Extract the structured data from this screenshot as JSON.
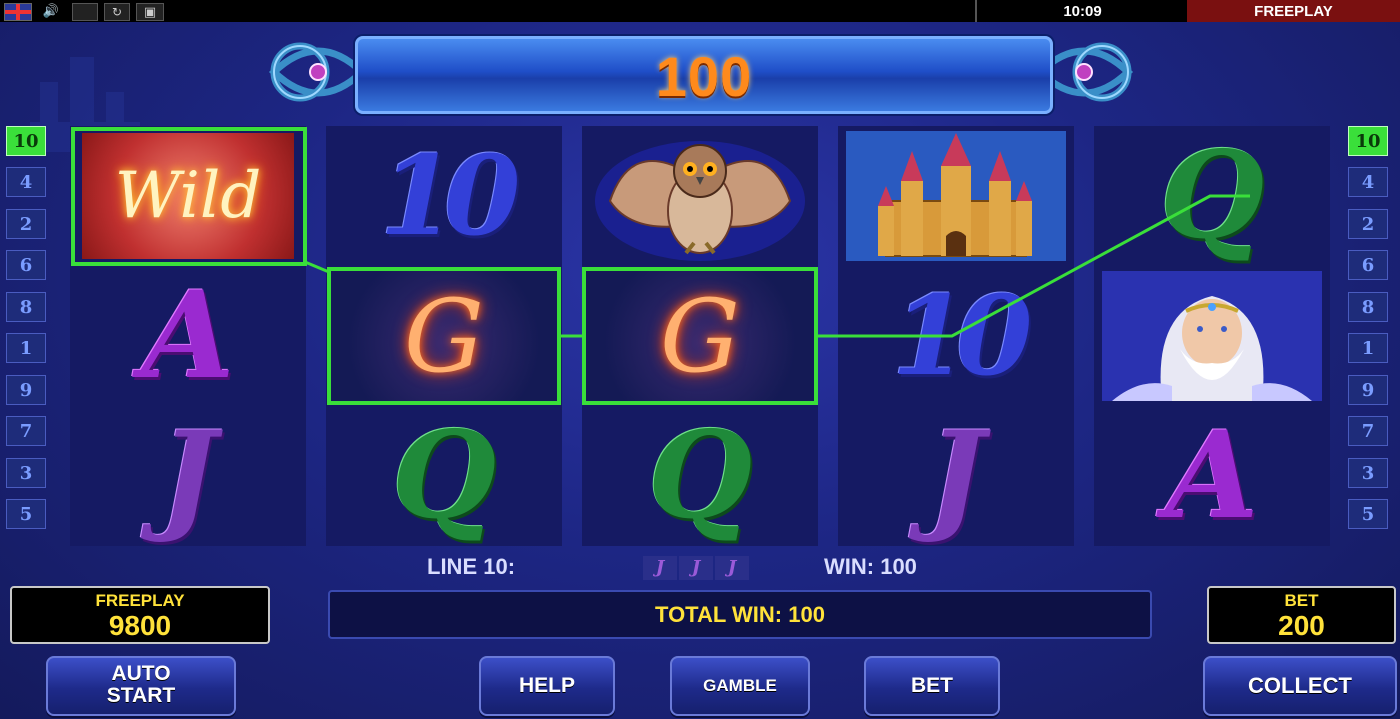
{
  "topbar": {
    "clock": "10:09",
    "mode_label": "FREEPLAY",
    "icons": [
      "uk-flag-icon",
      "speaker-icon",
      "fullscreen-icon",
      "reload-icon",
      "window-icon"
    ]
  },
  "win_display": {
    "value": "100"
  },
  "lines": {
    "left": [
      "10",
      "4",
      "2",
      "6",
      "8",
      "1",
      "9",
      "7",
      "3",
      "5"
    ],
    "right": [
      "10",
      "4",
      "2",
      "6",
      "8",
      "1",
      "9",
      "7",
      "3",
      "5"
    ],
    "active": "10"
  },
  "reels": [
    [
      "wild",
      "A",
      "J"
    ],
    [
      "10",
      "G",
      "Q"
    ],
    [
      "owl",
      "G",
      "Q"
    ],
    [
      "castle",
      "10",
      "J"
    ],
    [
      "Q",
      "wizard",
      "A"
    ]
  ],
  "symbols": {
    "wild_text": "Wild",
    "g_glyph": "G",
    "ten": "10",
    "q": "Q",
    "a": "A",
    "j": "J"
  },
  "line_info": {
    "label": "LINE 10:",
    "mini_symbols": [
      "J",
      "J",
      "J"
    ],
    "win_label": "WIN: 100"
  },
  "total_win": "TOTAL WIN: 100",
  "credit_meter": {
    "label": "FREEPLAY",
    "value": "9800"
  },
  "bet_meter": {
    "label": "BET",
    "value": "200"
  },
  "buttons": {
    "autostart_line1": "AUTO",
    "autostart_line2": "START",
    "help": "HELP",
    "gamble": "GAMBLE",
    "bet": "BET",
    "collect": "COLLECT"
  },
  "colors": {
    "win_line": "#3adf3a",
    "meter_text": "#ffe23a",
    "win_value": "#ff8a1c",
    "freeplay_tab": "#7a1010"
  }
}
